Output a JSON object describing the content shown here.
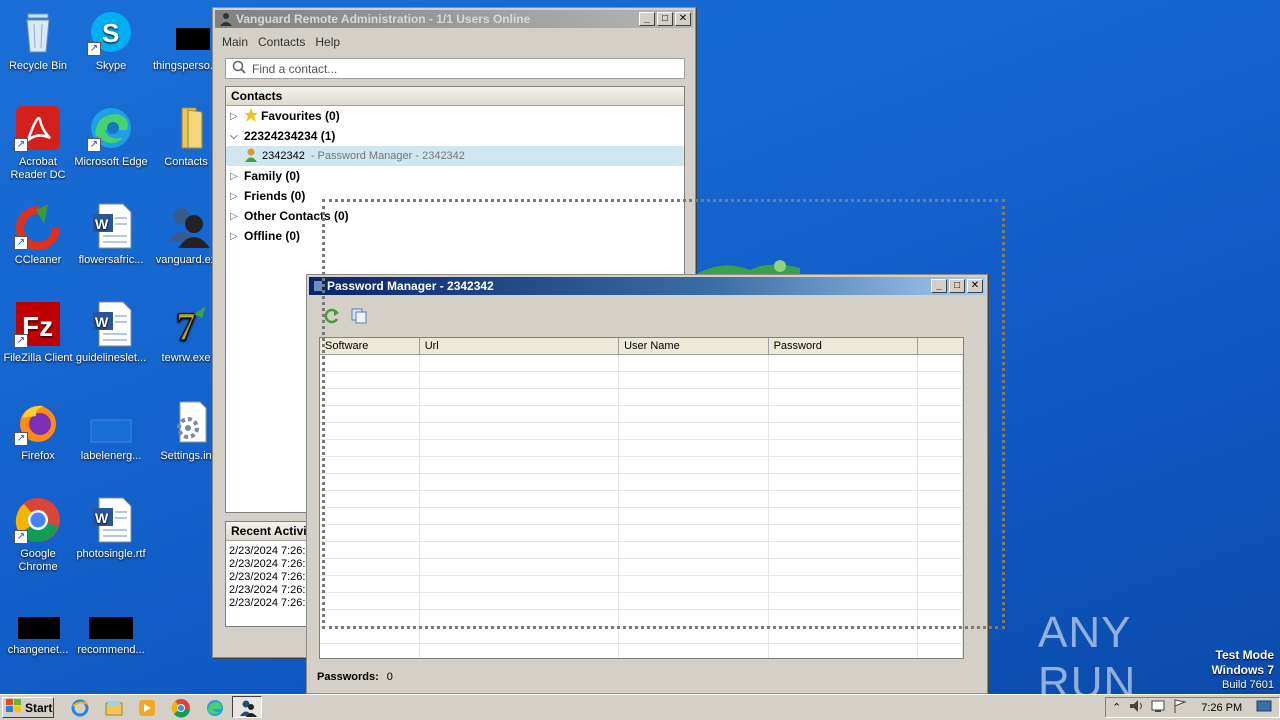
{
  "desktop_icons": [
    {
      "label": "Recycle Bin"
    },
    {
      "label": "Skype"
    },
    {
      "label": "thingsperso..."
    },
    {
      "label": "Acrobat Reader DC"
    },
    {
      "label": "Microsoft Edge"
    },
    {
      "label": "Contacts"
    },
    {
      "label": "CCleaner"
    },
    {
      "label": "flowersafric..."
    },
    {
      "label": "vanguard.ex"
    },
    {
      "label": "FileZilla Client"
    },
    {
      "label": "guidelineslet..."
    },
    {
      "label": "tewrw.exe"
    },
    {
      "label": "Firefox"
    },
    {
      "label": "labelenerg..."
    },
    {
      "label": "Settings.in"
    },
    {
      "label": "Google Chrome"
    },
    {
      "label": "photosingle.rtf"
    },
    {
      "label": "changenet..."
    },
    {
      "label": "recommend..."
    }
  ],
  "vanguard": {
    "title": "Vanguard Remote Administration - 1/1 Users Online",
    "menu": [
      "Main",
      "Contacts",
      "Help"
    ],
    "search_placeholder": "Find a contact...",
    "contacts_header": "Contacts",
    "groups": [
      {
        "label": "Favourites (0)",
        "expanded": false
      },
      {
        "label": "22324234234 (1)",
        "expanded": true
      },
      {
        "label": "Family (0)",
        "expanded": false
      },
      {
        "label": "Friends (0)",
        "expanded": false
      },
      {
        "label": "Other Contacts (0)",
        "expanded": false
      },
      {
        "label": "Offline (0)",
        "expanded": false
      }
    ],
    "contact": {
      "name": "2342342",
      "detail": "- Password Manager - 2342342"
    },
    "recent_header": "Recent Activi",
    "recent_items": [
      "2/23/2024 7:26:",
      "2/23/2024 7:26:",
      "2/23/2024 7:26:",
      "2/23/2024 7:26:",
      "2/23/2024 7:26:"
    ]
  },
  "password_manager": {
    "title": "Password Manager - 2342342",
    "columns": [
      "Software",
      "Url",
      "User Name",
      "Password"
    ],
    "rows": [],
    "passwords_label": "Passwords:",
    "passwords_count": "0"
  },
  "watermark": {
    "brand": "ANY RUN",
    "mode": "Test Mode",
    "os": "Windows 7",
    "build": "Build 7601"
  },
  "taskbar": {
    "start_label": "Start",
    "clock": "7:26 PM"
  }
}
